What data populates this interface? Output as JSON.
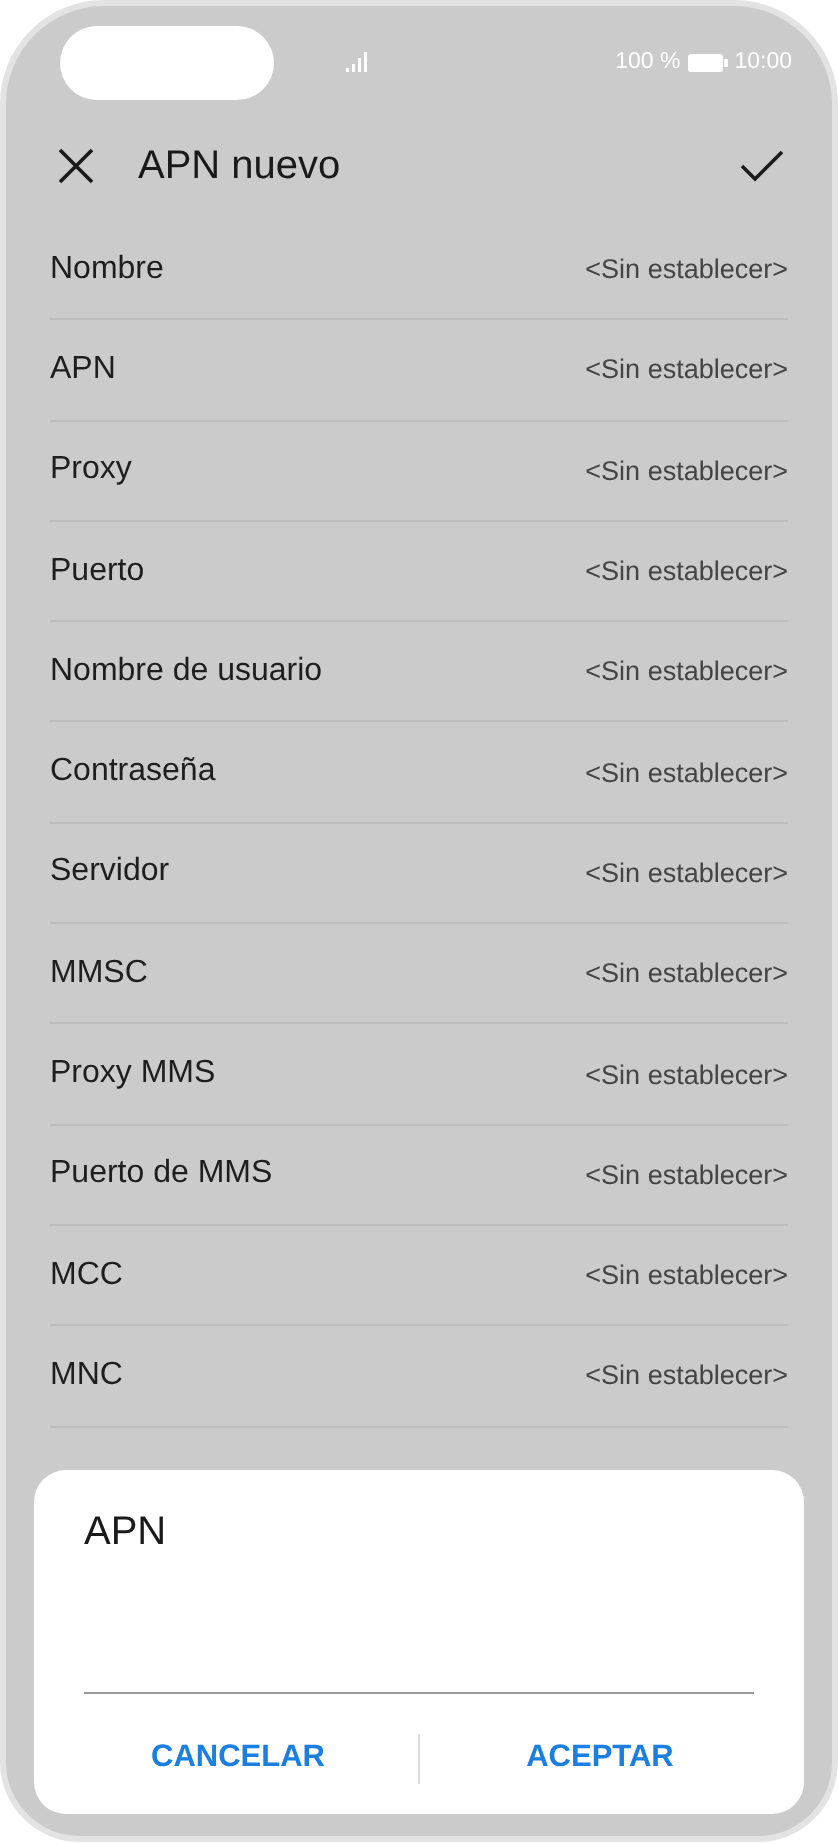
{
  "status_bar": {
    "battery_text": "100 %",
    "time": "10:00"
  },
  "toolbar": {
    "title": "APN nuevo"
  },
  "settings": [
    {
      "label": "Nombre",
      "value": "<Sin establecer>"
    },
    {
      "label": "APN",
      "value": "<Sin establecer>"
    },
    {
      "label": "Proxy",
      "value": "<Sin establecer>"
    },
    {
      "label": "Puerto",
      "value": "<Sin establecer>"
    },
    {
      "label": "Nombre de usuario",
      "value": "<Sin establecer>"
    },
    {
      "label": "Contraseña",
      "value": "<Sin establecer>"
    },
    {
      "label": "Servidor",
      "value": "<Sin establecer>"
    },
    {
      "label": "MMSC",
      "value": "<Sin establecer>"
    },
    {
      "label": "Proxy MMS",
      "value": "<Sin establecer>"
    },
    {
      "label": "Puerto de MMS",
      "value": "<Sin establecer>"
    },
    {
      "label": "MCC",
      "value": "<Sin establecer>"
    },
    {
      "label": "MNC",
      "value": "<Sin establecer>"
    }
  ],
  "dialog": {
    "title": "APN",
    "buttons": [
      "CANCELAR",
      "ACEPTAR"
    ]
  }
}
